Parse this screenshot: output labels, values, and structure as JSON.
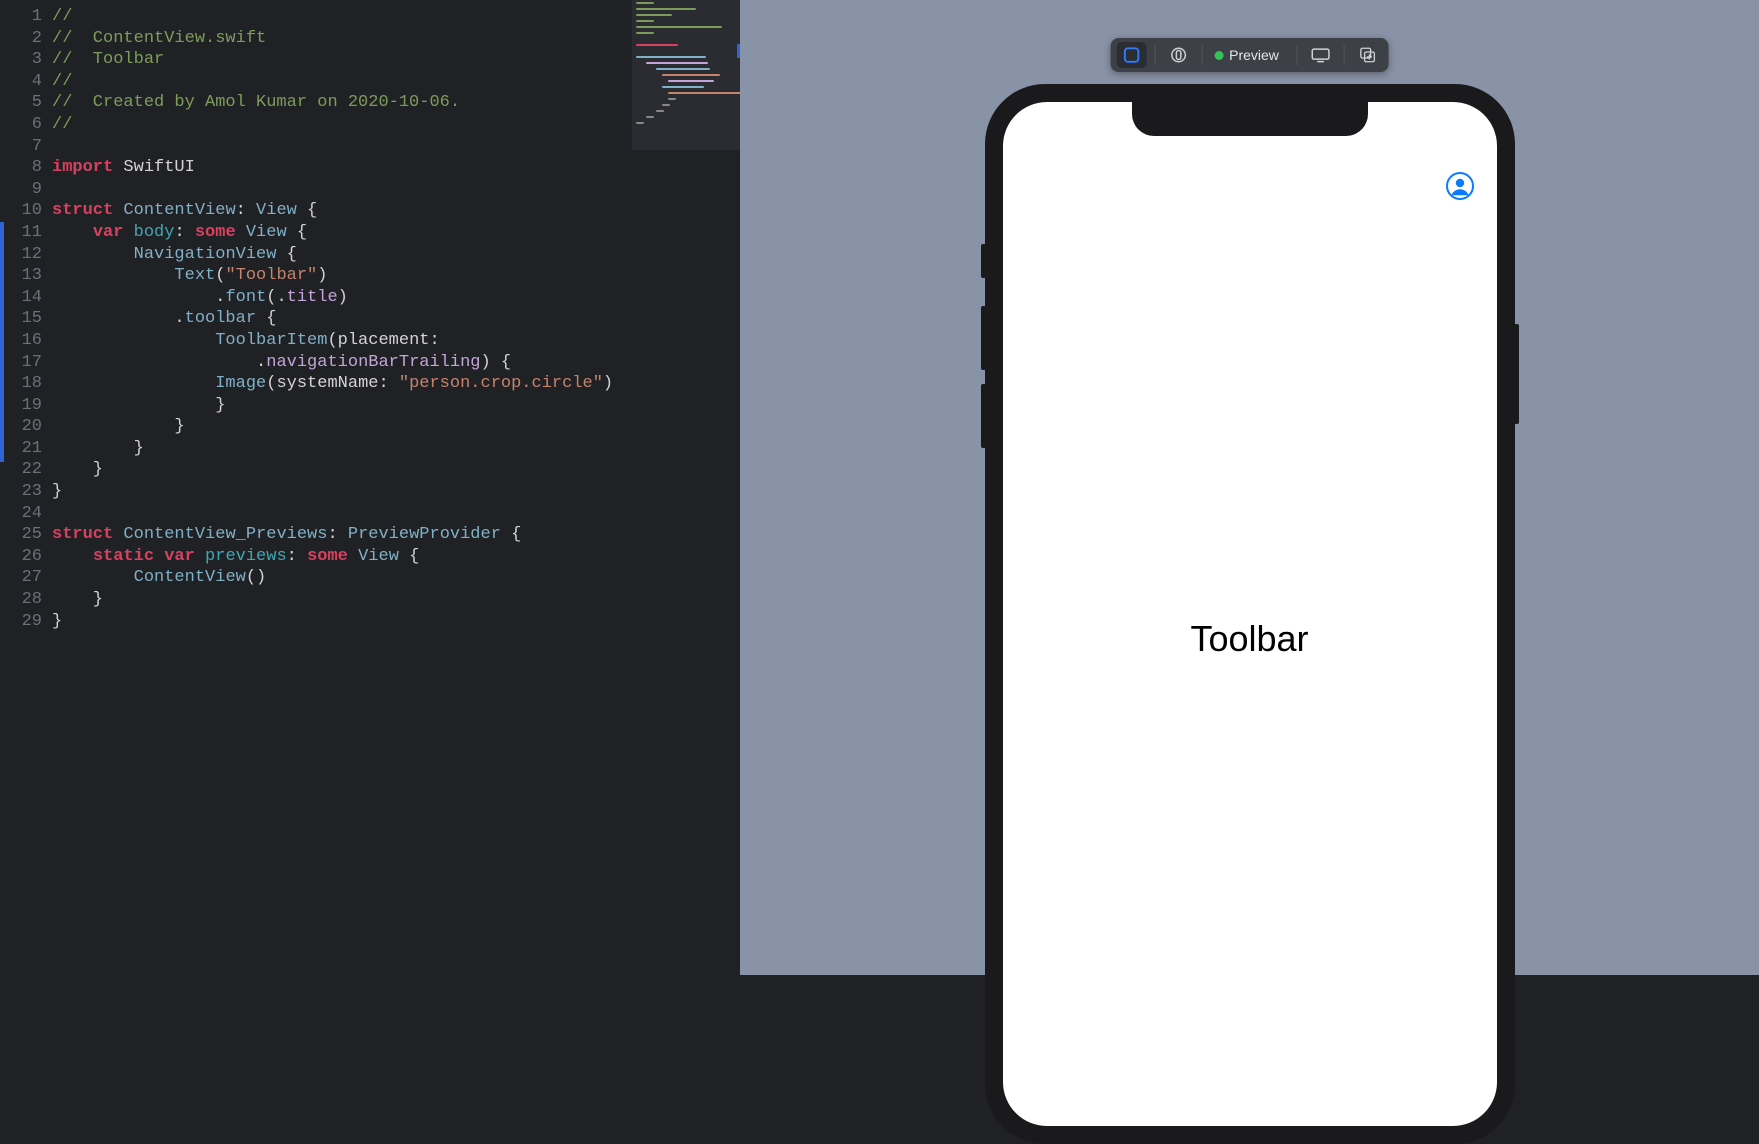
{
  "editor": {
    "lines": [
      {
        "n": 1,
        "seg": [
          {
            "c": "comment",
            "t": "//"
          }
        ]
      },
      {
        "n": 2,
        "seg": [
          {
            "c": "comment",
            "t": "//  ContentView.swift"
          }
        ]
      },
      {
        "n": 3,
        "seg": [
          {
            "c": "comment",
            "t": "//  Toolbar"
          }
        ]
      },
      {
        "n": 4,
        "seg": [
          {
            "c": "comment",
            "t": "//"
          }
        ]
      },
      {
        "n": 5,
        "seg": [
          {
            "c": "comment",
            "t": "//  Created by Amol Kumar on 2020-10-06."
          }
        ]
      },
      {
        "n": 6,
        "seg": [
          {
            "c": "comment",
            "t": "//"
          }
        ]
      },
      {
        "n": 7,
        "seg": []
      },
      {
        "n": 8,
        "seg": [
          {
            "c": "keyword",
            "t": "import"
          },
          {
            "c": "ident",
            "t": " SwiftUI"
          }
        ]
      },
      {
        "n": 9,
        "seg": []
      },
      {
        "n": 10,
        "seg": [
          {
            "c": "keyword",
            "t": "struct"
          },
          {
            "c": "ident",
            "t": " "
          },
          {
            "c": "type",
            "t": "ContentView"
          },
          {
            "c": "punct",
            "t": ": "
          },
          {
            "c": "type",
            "t": "View"
          },
          {
            "c": "punct",
            "t": " {"
          }
        ]
      },
      {
        "n": 11,
        "seg": [
          {
            "c": "ident",
            "t": "    "
          },
          {
            "c": "keyword",
            "t": "var"
          },
          {
            "c": "ident",
            "t": " "
          },
          {
            "c": "member",
            "t": "body"
          },
          {
            "c": "punct",
            "t": ": "
          },
          {
            "c": "keyword",
            "t": "some"
          },
          {
            "c": "ident",
            "t": " "
          },
          {
            "c": "type",
            "t": "View"
          },
          {
            "c": "punct",
            "t": " {"
          }
        ]
      },
      {
        "n": 12,
        "seg": [
          {
            "c": "ident",
            "t": "        "
          },
          {
            "c": "type",
            "t": "NavigationView"
          },
          {
            "c": "punct",
            "t": " {"
          }
        ]
      },
      {
        "n": 13,
        "seg": [
          {
            "c": "ident",
            "t": "            "
          },
          {
            "c": "type",
            "t": "Text"
          },
          {
            "c": "punct",
            "t": "("
          },
          {
            "c": "string",
            "t": "\"Toolbar\""
          },
          {
            "c": "punct",
            "t": ")"
          }
        ]
      },
      {
        "n": 14,
        "seg": [
          {
            "c": "ident",
            "t": "                ."
          },
          {
            "c": "func",
            "t": "font"
          },
          {
            "c": "punct",
            "t": "(."
          },
          {
            "c": "prop",
            "t": "title"
          },
          {
            "c": "punct",
            "t": ")"
          }
        ]
      },
      {
        "n": 15,
        "seg": [
          {
            "c": "ident",
            "t": "            ."
          },
          {
            "c": "func",
            "t": "toolbar"
          },
          {
            "c": "punct",
            "t": " {"
          }
        ]
      },
      {
        "n": 16,
        "seg": [
          {
            "c": "ident",
            "t": "                "
          },
          {
            "c": "type",
            "t": "ToolbarItem"
          },
          {
            "c": "punct",
            "t": "(placement:"
          }
        ]
      },
      {
        "n": "",
        "seg": [
          {
            "c": "ident",
            "t": "                    ."
          },
          {
            "c": "prop",
            "t": "navigationBarTrailing"
          },
          {
            "c": "punct",
            "t": ") {"
          }
        ]
      },
      {
        "n": 17,
        "seg": [
          {
            "c": "ident",
            "t": "                "
          },
          {
            "c": "type",
            "t": "Image"
          },
          {
            "c": "punct",
            "t": "(systemName: "
          },
          {
            "c": "string",
            "t": "\"person.crop.circle\""
          },
          {
            "c": "punct",
            "t": ")"
          }
        ]
      },
      {
        "n": 18,
        "seg": [
          {
            "c": "punct",
            "t": "                }"
          }
        ]
      },
      {
        "n": 19,
        "seg": [
          {
            "c": "punct",
            "t": "            }"
          }
        ]
      },
      {
        "n": 20,
        "seg": [
          {
            "c": "punct",
            "t": "        }"
          }
        ]
      },
      {
        "n": 21,
        "seg": [
          {
            "c": "punct",
            "t": "    }"
          }
        ]
      },
      {
        "n": 22,
        "seg": [
          {
            "c": "punct",
            "t": "}"
          }
        ]
      },
      {
        "n": 23,
        "seg": []
      },
      {
        "n": 24,
        "seg": [
          {
            "c": "keyword",
            "t": "struct"
          },
          {
            "c": "ident",
            "t": " "
          },
          {
            "c": "type",
            "t": "ContentView_Previews"
          },
          {
            "c": "punct",
            "t": ": "
          },
          {
            "c": "type",
            "t": "PreviewProvider"
          },
          {
            "c": "punct",
            "t": " {"
          }
        ]
      },
      {
        "n": 25,
        "seg": [
          {
            "c": "ident",
            "t": "    "
          },
          {
            "c": "keyword",
            "t": "static"
          },
          {
            "c": "ident",
            "t": " "
          },
          {
            "c": "keyword",
            "t": "var"
          },
          {
            "c": "ident",
            "t": " "
          },
          {
            "c": "member",
            "t": "previews"
          },
          {
            "c": "punct",
            "t": ": "
          },
          {
            "c": "keyword",
            "t": "some"
          },
          {
            "c": "ident",
            "t": " "
          },
          {
            "c": "type",
            "t": "View"
          },
          {
            "c": "punct",
            "t": " {"
          }
        ]
      },
      {
        "n": 26,
        "seg": [
          {
            "c": "ident",
            "t": "        "
          },
          {
            "c": "type",
            "t": "ContentView"
          },
          {
            "c": "punct",
            "t": "()"
          }
        ]
      },
      {
        "n": 27,
        "seg": [
          {
            "c": "punct",
            "t": "    }"
          }
        ]
      },
      {
        "n": 28,
        "seg": [
          {
            "c": "punct",
            "t": "}"
          }
        ]
      },
      {
        "n": 29,
        "seg": []
      }
    ]
  },
  "preview_toolbar": {
    "label": "Preview"
  },
  "app_preview": {
    "title_text": "Toolbar"
  }
}
